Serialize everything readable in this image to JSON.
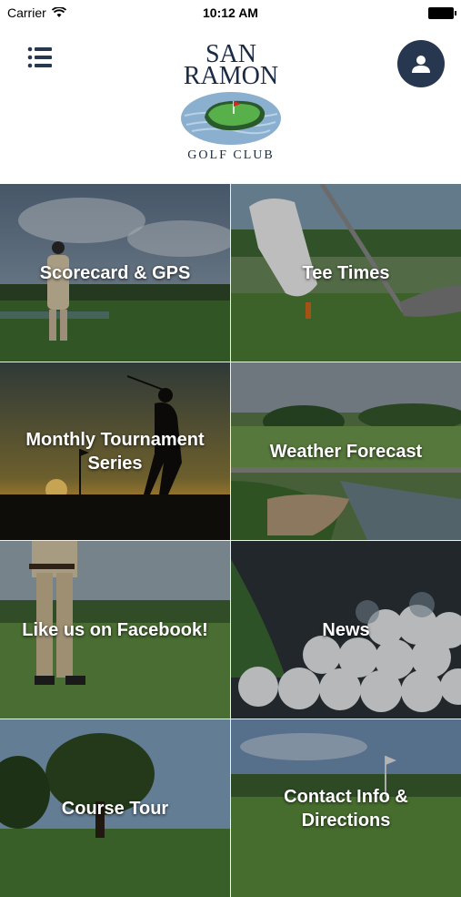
{
  "status_bar": {
    "carrier": "Carrier",
    "time": "10:12 AM"
  },
  "header": {
    "logo": {
      "line1": "SAN",
      "line2": "RAMON",
      "line3": "GOLF CLUB"
    },
    "menu_icon": "list-icon",
    "profile_icon": "user-icon",
    "accent_color": "#26374f"
  },
  "tiles": [
    {
      "label": "Scorecard & GPS"
    },
    {
      "label": "Tee Times"
    },
    {
      "label": "Monthly Tournament\nSeries"
    },
    {
      "label": "Weather Forecast"
    },
    {
      "label": "Like us on Facebook!"
    },
    {
      "label": "News"
    },
    {
      "label": "Course Tour"
    },
    {
      "label": "Contact Info & Directions"
    }
  ]
}
